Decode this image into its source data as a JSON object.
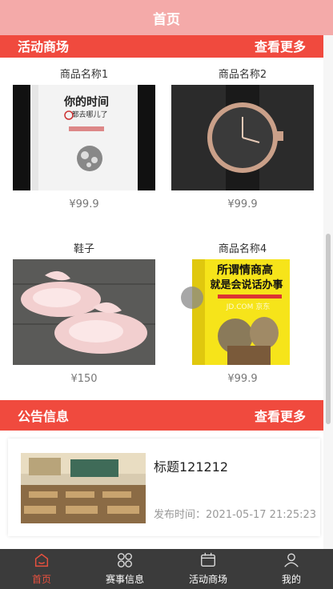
{
  "header": {
    "title": "首页"
  },
  "section_products": {
    "title": "活动商场",
    "more": "查看更多"
  },
  "products": [
    {
      "name": "商品名称1",
      "price": "¥99.9",
      "image_alt": "你的时间都去哪儿了"
    },
    {
      "name": "商品名称2",
      "price": "¥99.9",
      "image_alt": "watch"
    },
    {
      "name": "鞋子",
      "price": "¥150",
      "image_alt": "shoes"
    },
    {
      "name": "商品名称4",
      "price": "¥99.9",
      "image_alt": "所谓情商高就是会说话办事"
    }
  ],
  "book1": {
    "title": "你的时间",
    "subtitle": "都去哪儿了"
  },
  "book2": {
    "title1": "所谓情商高",
    "title2": "就是会说话办事",
    "watermark": "JD.COM 京东"
  },
  "section_notice": {
    "title": "公告信息",
    "more": "查看更多"
  },
  "notice": {
    "title": "标题121212",
    "time": "发布时间：2021-05-17 21:25:23"
  },
  "tabbar": {
    "items": [
      {
        "label": "首页",
        "icon": "home-icon",
        "active": true
      },
      {
        "label": "赛事信息",
        "icon": "grid-icon",
        "active": false
      },
      {
        "label": "活动商场",
        "icon": "store-icon",
        "active": false
      },
      {
        "label": "我的",
        "icon": "user-icon",
        "active": false
      }
    ]
  },
  "colors": {
    "accent": "#f04a3e",
    "header": "#f4aaa9",
    "tabbar": "#3b3b3b",
    "active": "#e8513f"
  }
}
